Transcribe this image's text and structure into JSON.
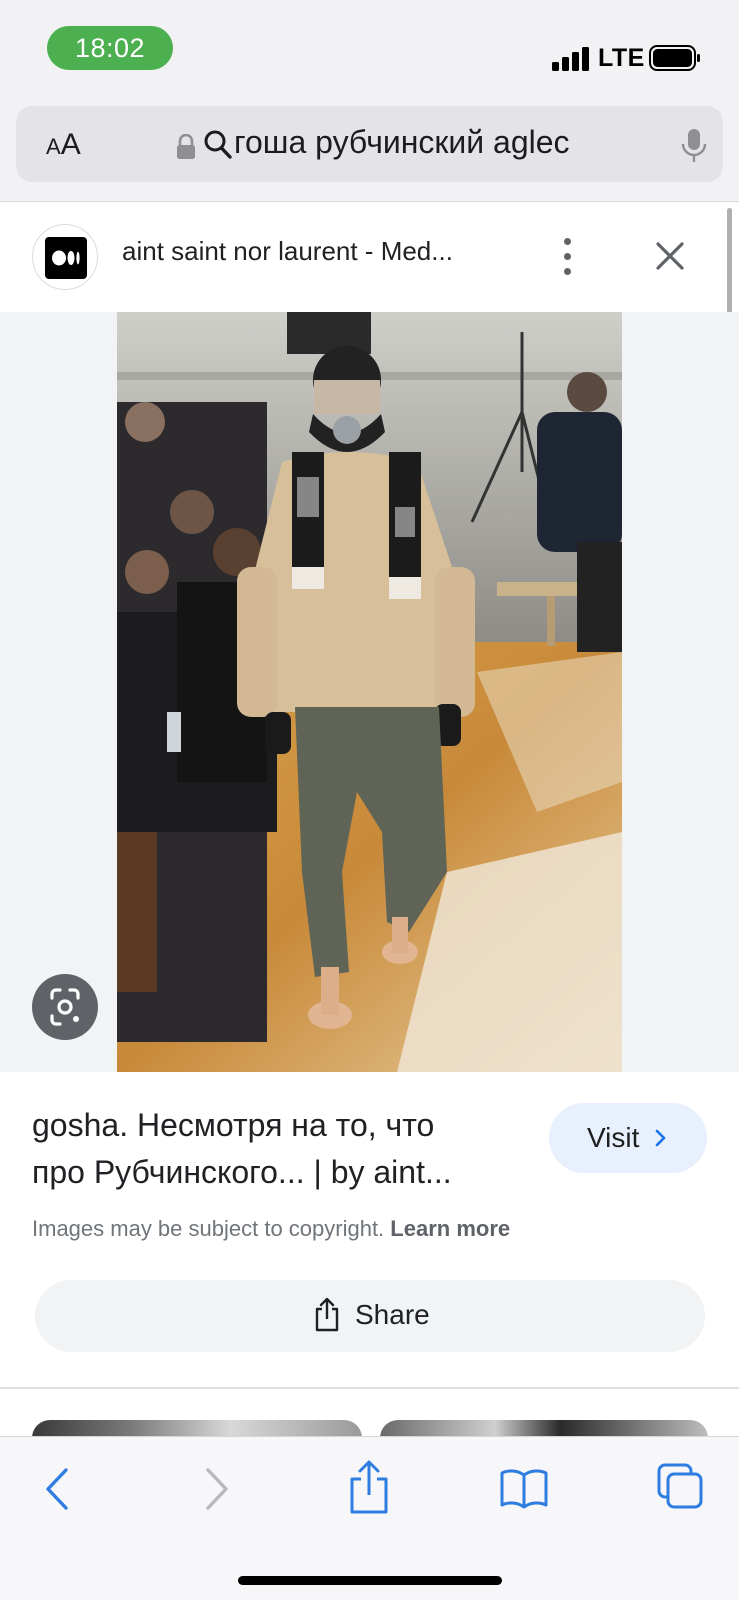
{
  "status_bar": {
    "time": "18:02",
    "network": "LTE",
    "icons": [
      "signal-icon",
      "battery-icon"
    ]
  },
  "address_bar": {
    "text_size_label": "AA",
    "query": "гоша рубчинский aglec",
    "icons": [
      "lock-icon",
      "search-icon",
      "microphone-icon"
    ]
  },
  "panel": {
    "site_title": "aint saint nor laurent - Med...",
    "icons": [
      "medium-logo-icon",
      "more-vert-icon",
      "close-icon"
    ]
  },
  "result": {
    "caption_line1": "gosha. Несмотря на то, что",
    "caption_line2": "про Рубчинского... | by aint...",
    "visit_label": "Visit",
    "copyright_text": "Images may be subject to copyright.",
    "learn_more": "Learn more",
    "share_label": "Share"
  },
  "bottom_toolbar": {
    "icons": [
      "back-icon",
      "forward-icon",
      "share-icon",
      "bookmarks-icon",
      "tabs-icon"
    ]
  },
  "colors": {
    "time_pill": "#4caf50",
    "visit_button_bg": "#e8f0fe",
    "safari_blue": "#2f7de1",
    "disabled_gray": "#b8b8bd"
  }
}
